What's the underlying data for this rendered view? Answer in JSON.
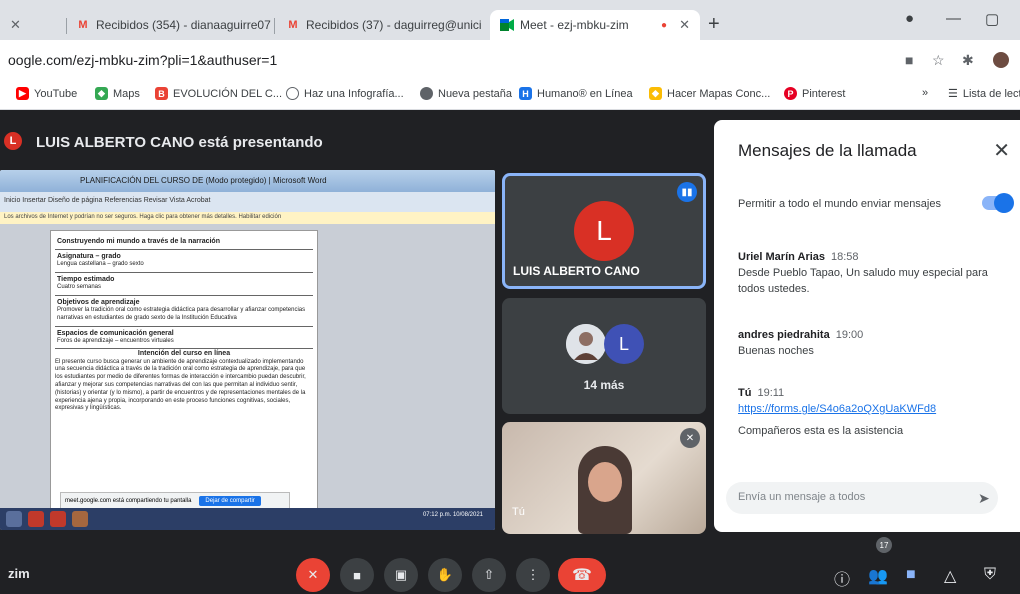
{
  "browser": {
    "tabs": [
      {
        "title": "Recibidos (354) - dianaaguirre07",
        "favicon": "M"
      },
      {
        "title": "Recibidos (37) - daguirreg@unici",
        "favicon": "M"
      },
      {
        "title": "Meet - ezj-mbku-zim",
        "favicon": "meet"
      }
    ],
    "new_tab": "+",
    "url": "oogle.com/ezj-mbku-zim?pli=1&authuser=1",
    "bookmarks": [
      {
        "label": "YouTube",
        "color": "#ff0000"
      },
      {
        "label": "Maps",
        "color": "#34a853"
      },
      {
        "label": "EVOLUCIÓN DEL C...",
        "color": "#ea4335"
      },
      {
        "label": "Haz una Infografía...",
        "color": "#5f6368"
      },
      {
        "label": "Nueva pestaña",
        "color": "#5f6368"
      },
      {
        "label": "Humano® en Línea",
        "color": "#1a73e8"
      },
      {
        "label": "Hacer Mapas Conc...",
        "color": "#fbbc04"
      },
      {
        "label": "Pinterest",
        "color": "#e60023"
      }
    ],
    "bookmarks_overflow": "»",
    "reading_list": "Lista de lect"
  },
  "meet": {
    "presenter_initial": "L",
    "presenter_title": "LUIS ALBERTO CANO está presentando",
    "shared_screen": {
      "window_title": "PLANIFICACIÓN DEL CURSO DE (Modo protegido) | Microsoft Word",
      "ribbon": "Inicio   Insertar   Diseño de página   Referencias   Revisar   Vista   Acrobat",
      "message_bar": "Los archivos de Internet y podrían no ser seguros. Haga clic para obtener más detalles.   Habilitar edición",
      "rows": [
        {
          "heading": "Construyendo mi mundo a través de la narración",
          "text": ""
        },
        {
          "heading": "Asignatura – grado",
          "text": "Lengua castellana – grado sexto"
        },
        {
          "heading": "Tiempo estimado",
          "text": "Cuatro semanas"
        },
        {
          "heading": "Objetivos de aprendizaje",
          "text": "Promover la tradición oral como estrategia didáctica para desarrollar y afianzar competencias narrativas en estudiantes de grado sexto de la Institución Educativa"
        },
        {
          "heading": "Espacios de comunicación general",
          "text": "Foros de aprendizaje – encuentros virtuales"
        }
      ],
      "section_title": "Intención del curso en línea",
      "body": "El presente curso busca generar un ambiente de aprendizaje contextualizado implementando una secuencia didáctica a través de la tradición oral como estrategia de aprendizaje, para que los estudiantes por medio de diferentes formas de interacción e intercambio puedan descubrir, afianzar y mejorar sus competencias narrativas del con las que permitan al individuo sentir, (historias) y orientar (y lo mismo), a partir de encuentros y de representaciones mentales de la experiencia ajena y propia, incorporando en este proceso funciones cognitivas, sociales, expresivas y lingüísticas.",
      "notify_text": "meet.google.com está compartiendo tu pantalla",
      "notify_button": "Dejar de compartir",
      "clock": "07:12 p.m. 10/08/2021"
    },
    "main_tile": {
      "initial": "L",
      "name": "LUIS ALBERTO CANO"
    },
    "more_tile": {
      "initial": "L",
      "label": "14 más"
    },
    "self_tile": {
      "label": "Tú"
    }
  },
  "chat": {
    "title": "Mensajes de la llamada",
    "allow_label": "Permitir a todo el mundo enviar mensajes",
    "allow_enabled": true,
    "messages": [
      {
        "sender": "Uriel Marín Arias",
        "time": "18:58",
        "text": "Desde Pueblo Tapao, Un saludo muy especial para todos ustedes."
      },
      {
        "sender": "andres piedrahita",
        "time": "19:00",
        "text": "Buenas noches"
      },
      {
        "sender": "Tú",
        "time": "19:11",
        "link": "https://forms.gle/S4o6a2oQXgUaKWFd8",
        "text": "Compañeros esta es la asistencia"
      }
    ],
    "input_placeholder": "Envía un mensaje a todos"
  },
  "controls": {
    "meeting_code": "zim",
    "participants_count": "17"
  }
}
